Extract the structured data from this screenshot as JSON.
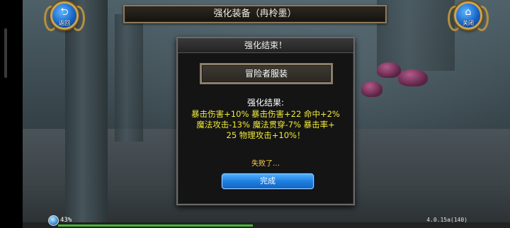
{
  "title_bar": {
    "text": "强化装备（冉柃墨）"
  },
  "back_button": {
    "label": "返回",
    "glyph": "⮌"
  },
  "close_button": {
    "label": "关闭",
    "glyph": "⌂"
  },
  "dialog": {
    "header": "强化结束！",
    "item_name": "冒险者服装",
    "result_title": "强化结果:",
    "result_lines": [
      "暴击伤害+10% 暴击伤害+22 命中+2%",
      "魔法攻击-13% 魔法贯穿-7% 暴击率+",
      "25 物理攻击+10%！"
    ],
    "fail_text": "失败了…",
    "done_button": "完成"
  },
  "status": {
    "percent": "43%",
    "progress": 0.43,
    "version": "4.0.15a(140)"
  },
  "colors": {
    "result_text": "#f0ea3a",
    "fail_text": "#ffd34a",
    "button_blue": "#1f7fe0",
    "progress_green": "#46b832"
  }
}
